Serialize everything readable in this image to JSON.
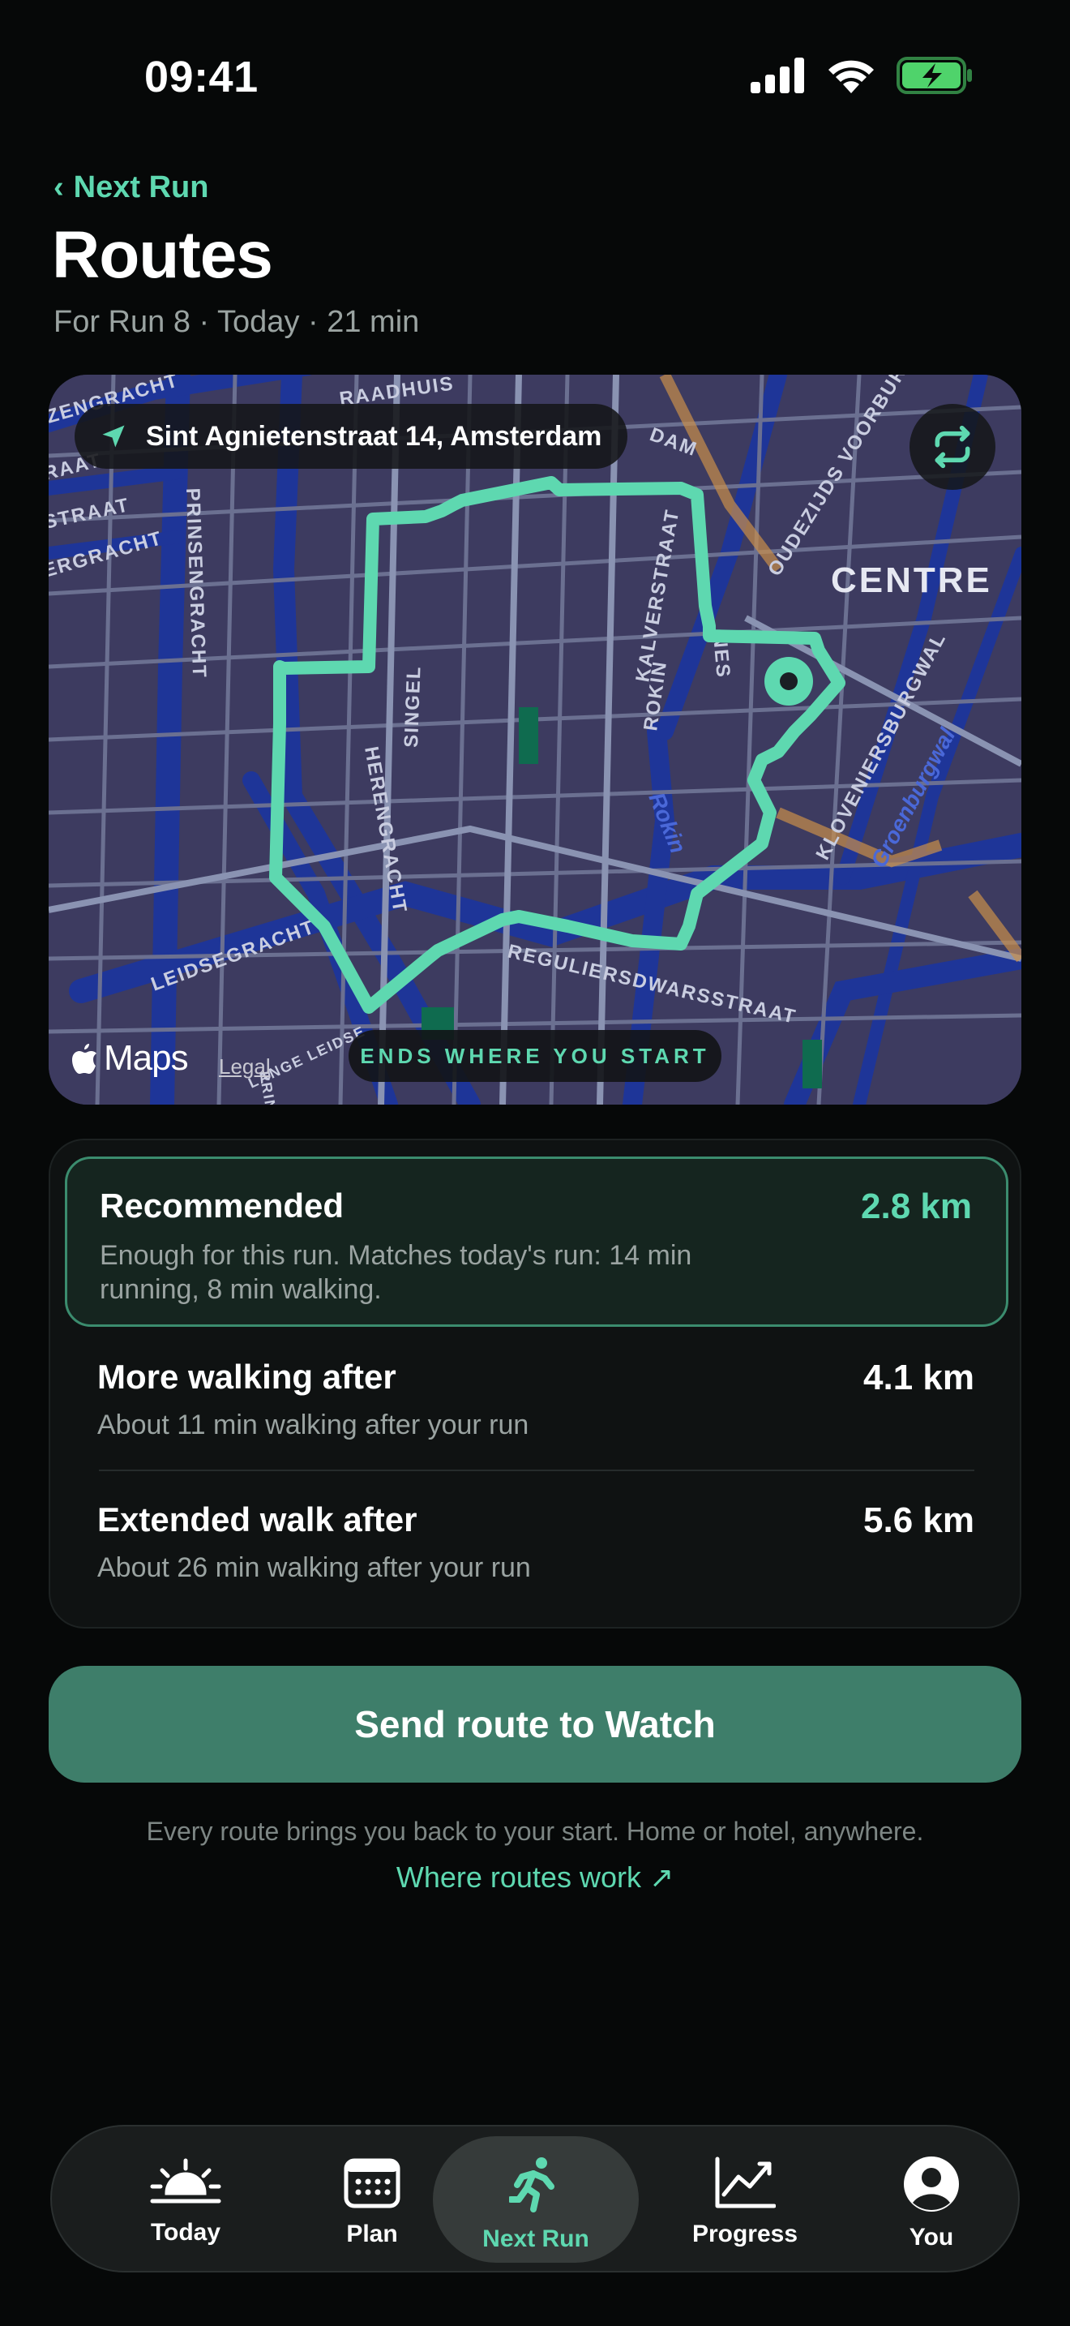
{
  "status_bar": {
    "time": "09:41"
  },
  "header": {
    "back_label": "Next Run",
    "title": "Routes",
    "subtitle": "For Run 8 · Today · 21 min"
  },
  "map": {
    "address": "Sint Agnietenstraat 14, Amsterdam",
    "badge": "ENDS WHERE YOU START",
    "provider": "Maps",
    "legal": "Legal",
    "district_label": "CENTRE",
    "street_labels": {
      "singel": "SINGEL",
      "herengracht": "HERENGRACHT",
      "kalverstraat": "KALVERSTRAAT",
      "rokin_street": "ROKIN",
      "rokin_water": "Rokin",
      "nes": "NES",
      "prinsengracht": "PRINSENGRACHT",
      "leidsegracht": "LEIDSEGRACHT",
      "reguliersdwarsstraat": "REGULIERSDWARSSTRAAT",
      "oudezijds": "OUDEZIJDS VOORBURG",
      "kloveniersburgwal": "KLOVENIERSBURGWAL",
      "groenburgwal": "Groenburgwal",
      "straat_left": "STRAAT",
      "raat_left": "RAAT",
      "gracht_left": "ERGRACHT",
      "gracht_top": "ZENGRACHT",
      "dam": "DAM",
      "raadhuis": "RAADHUIS",
      "laag": "LANGE LEIDSE",
      "prins_bottom": "PRINS"
    },
    "route_color": "#5ed8b0"
  },
  "routes": [
    {
      "name": "Recommended",
      "description": "Enough for this run. Matches today's run: 14 min running, 8 min walking.",
      "distance": "2.8 km",
      "selected": true
    },
    {
      "name": "More walking after",
      "description": "About 11 min walking after your run",
      "distance": "4.1 km",
      "selected": false
    },
    {
      "name": "Extended walk after",
      "description": "About 26 min walking after your run",
      "distance": "5.6 km",
      "selected": false
    }
  ],
  "cta": {
    "send_label": "Send route to Watch"
  },
  "footer": {
    "note": "Every route brings you back to your start. Home or hotel, anywhere.",
    "link": "Where routes work ↗"
  },
  "tabs": [
    {
      "label": "Today",
      "icon": "sunrise-icon",
      "active": false
    },
    {
      "label": "Plan",
      "icon": "calendar-icon",
      "active": false
    },
    {
      "label": "Next Run",
      "icon": "runner-icon",
      "active": true
    },
    {
      "label": "Progress",
      "icon": "chart-icon",
      "active": false
    },
    {
      "label": "You",
      "icon": "person-icon",
      "active": false
    }
  ],
  "colors": {
    "accent": "#5ed8b0",
    "background": "#060808",
    "button": "#3e7e6a",
    "map_block": "#3a3a5e",
    "map_water": "#1e3598"
  }
}
